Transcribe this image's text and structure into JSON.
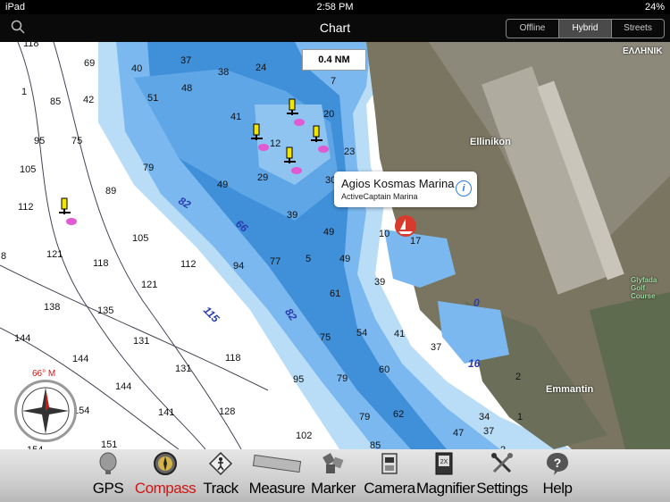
{
  "status_bar": {
    "carrier": "iPad",
    "time": "2:58 PM",
    "battery": "24%"
  },
  "nav": {
    "title": "Chart",
    "map_modes": [
      "Offline",
      "Hybrid",
      "Streets"
    ],
    "active_mode": "Hybrid"
  },
  "map": {
    "scale_label": "0.4 NM",
    "heading_label": "66° M",
    "popup": {
      "name": "Agios Kosmas Marina",
      "subtitle": "ActiveCaptain Marina"
    },
    "places": [
      "ΕΛΛΗΝΙΚ",
      "Ellinikon",
      "Emmantin",
      "Glyfada Golf Course"
    ],
    "depths": [
      "118",
      "69",
      "40",
      "37",
      "38",
      "24",
      "51",
      "48",
      "85",
      "42",
      "41",
      "20",
      "95",
      "75",
      "12",
      "23",
      "105",
      "79",
      "29",
      "30",
      "89",
      "49",
      "39",
      "112",
      "105",
      "49",
      "10",
      "17",
      "121",
      "118",
      "112",
      "94",
      "77",
      "5",
      "49",
      "121",
      "61",
      "39",
      "138",
      "135",
      "75",
      "54",
      "41",
      "37",
      "144",
      "131",
      "144",
      "118",
      "131",
      "60",
      "16",
      "0",
      "95",
      "79",
      "2",
      "144",
      "154",
      "141",
      "128",
      "62",
      "79",
      "34",
      "1",
      "151",
      "102",
      "85",
      "47",
      "37",
      "2",
      "154",
      "1",
      "8",
      "7"
    ],
    "contours": [
      "82",
      "66",
      "115",
      "82"
    ],
    "colors": {
      "deep": "#1d6fc1",
      "mid": "#3f8fd9",
      "shallow": "#7ab8ef",
      "land": "#7a7560"
    }
  },
  "toolbar": {
    "items": [
      {
        "label": "GPS",
        "icon": "satellite-dish-icon"
      },
      {
        "label": "Compass",
        "icon": "compass-icon"
      },
      {
        "label": "Track",
        "icon": "track-sign-icon"
      },
      {
        "label": "Measure",
        "icon": "ruler-icon"
      },
      {
        "label": "Marker",
        "icon": "marker-icon"
      },
      {
        "label": "Camera",
        "icon": "camera-icon"
      },
      {
        "label": "Magnifier",
        "icon": "magnifier-icon"
      },
      {
        "label": "Settings",
        "icon": "wrench-icon"
      },
      {
        "label": "Help",
        "icon": "help-icon"
      }
    ],
    "active": "Compass"
  }
}
